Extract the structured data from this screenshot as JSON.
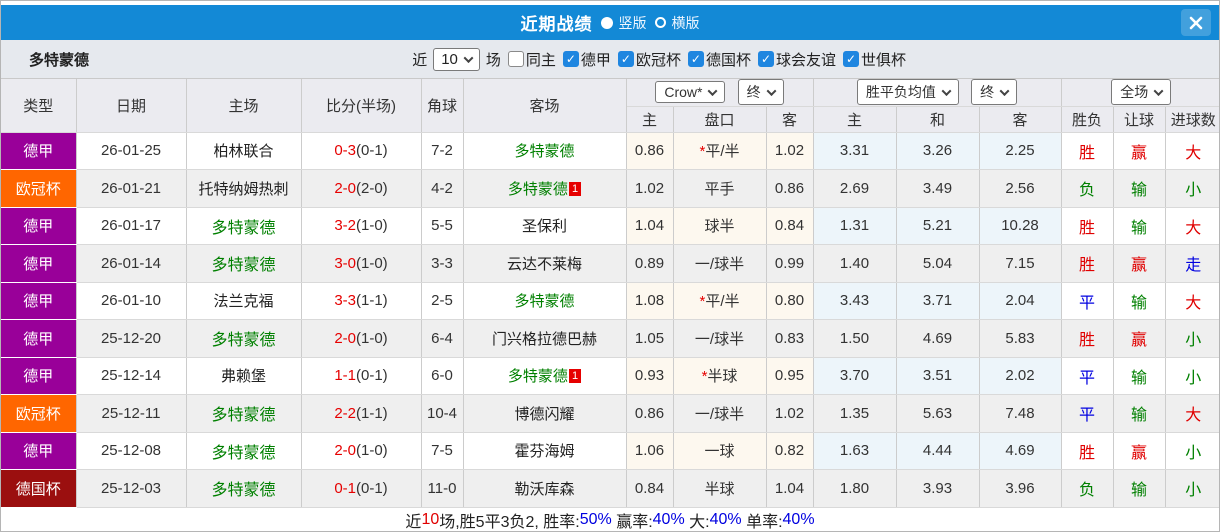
{
  "titlebar": {
    "title": "近期战绩",
    "layout_options": [
      {
        "label": "竖版",
        "selected": true
      },
      {
        "label": "横版",
        "selected": false
      }
    ]
  },
  "filter": {
    "team": "多特蒙德",
    "near_label": "近",
    "match_count": "10",
    "games_label": "场",
    "checkboxes": [
      {
        "label": "同主",
        "checked": false
      },
      {
        "label": "德甲",
        "checked": true
      },
      {
        "label": "欧冠杯",
        "checked": true
      },
      {
        "label": "德国杯",
        "checked": true
      },
      {
        "label": "球会友谊",
        "checked": true
      },
      {
        "label": "世俱杯",
        "checked": true
      }
    ]
  },
  "table": {
    "header_left": [
      "类型",
      "日期",
      "主场",
      "比分(半场)",
      "角球",
      "客场"
    ],
    "controls": {
      "odds_company": "Crow*",
      "odds_company_time": "终",
      "avg_select": "胜平负均值",
      "avg_time": "终",
      "scope_select": "全场"
    },
    "subheader": [
      "主",
      "盘口",
      "客",
      "主",
      "和",
      "客",
      "胜负",
      "让球",
      "进球数"
    ],
    "rows": [
      {
        "type": "德甲",
        "type_color": "purple",
        "date": "26-01-25",
        "home": "柏林联合",
        "home_color": "black",
        "score": "0-3",
        "half": "(0-1)",
        "corner": "7-2",
        "away": "多特蒙德",
        "away_color": "green",
        "away_badge": "",
        "odds_home": "0.86",
        "handicap_star": "*",
        "handicap": "平/半",
        "odds_away": "1.02",
        "avg_home": "3.31",
        "avg_draw": "3.26",
        "avg_away": "2.25",
        "outcome": "胜",
        "outcome_color": "red",
        "spread": "赢",
        "spread_color": "red",
        "goals": "大",
        "goals_color": "red"
      },
      {
        "type": "欧冠杯",
        "type_color": "orange",
        "date": "26-01-21",
        "home": "托特纳姆热刺",
        "home_color": "black",
        "score": "2-0",
        "half": "(2-0)",
        "corner": "4-2",
        "away": "多特蒙德",
        "away_color": "green",
        "away_badge": "1",
        "odds_home": "1.02",
        "handicap_star": "",
        "handicap": "平手",
        "odds_away": "0.86",
        "avg_home": "2.69",
        "avg_draw": "3.49",
        "avg_away": "2.56",
        "outcome": "负",
        "outcome_color": "green",
        "spread": "输",
        "spread_color": "green",
        "goals": "小",
        "goals_color": "green"
      },
      {
        "type": "德甲",
        "type_color": "purple",
        "date": "26-01-17",
        "home": "多特蒙德",
        "home_color": "green",
        "score": "3-2",
        "half": "(1-0)",
        "corner": "5-5",
        "away": "圣保利",
        "away_color": "black",
        "away_badge": "",
        "odds_home": "1.04",
        "handicap_star": "",
        "handicap": "球半",
        "odds_away": "0.84",
        "avg_home": "1.31",
        "avg_draw": "5.21",
        "avg_away": "10.28",
        "outcome": "胜",
        "outcome_color": "red",
        "spread": "输",
        "spread_color": "green",
        "goals": "大",
        "goals_color": "red"
      },
      {
        "type": "德甲",
        "type_color": "purple",
        "date": "26-01-14",
        "home": "多特蒙德",
        "home_color": "green",
        "score": "3-0",
        "half": "(1-0)",
        "corner": "3-3",
        "away": "云达不莱梅",
        "away_color": "black",
        "away_badge": "",
        "odds_home": "0.89",
        "handicap_star": "",
        "handicap": "一/球半",
        "odds_away": "0.99",
        "avg_home": "1.40",
        "avg_draw": "5.04",
        "avg_away": "7.15",
        "outcome": "胜",
        "outcome_color": "red",
        "spread": "赢",
        "spread_color": "red",
        "goals": "走",
        "goals_color": "blue"
      },
      {
        "type": "德甲",
        "type_color": "purple",
        "date": "26-01-10",
        "home": "法兰克福",
        "home_color": "black",
        "score": "3-3",
        "half": "(1-1)",
        "corner": "2-5",
        "away": "多特蒙德",
        "away_color": "green",
        "away_badge": "",
        "odds_home": "1.08",
        "handicap_star": "*",
        "handicap": "平/半",
        "odds_away": "0.80",
        "avg_home": "3.43",
        "avg_draw": "3.71",
        "avg_away": "2.04",
        "outcome": "平",
        "outcome_color": "blue",
        "spread": "输",
        "spread_color": "green",
        "goals": "大",
        "goals_color": "red"
      },
      {
        "type": "德甲",
        "type_color": "purple",
        "date": "25-12-20",
        "home": "多特蒙德",
        "home_color": "green",
        "score": "2-0",
        "half": "(1-0)",
        "corner": "6-4",
        "away": "门兴格拉德巴赫",
        "away_color": "black",
        "away_badge": "",
        "odds_home": "1.05",
        "handicap_star": "",
        "handicap": "一/球半",
        "odds_away": "0.83",
        "avg_home": "1.50",
        "avg_draw": "4.69",
        "avg_away": "5.83",
        "outcome": "胜",
        "outcome_color": "red",
        "spread": "赢",
        "spread_color": "red",
        "goals": "小",
        "goals_color": "green"
      },
      {
        "type": "德甲",
        "type_color": "purple",
        "date": "25-12-14",
        "home": "弗赖堡",
        "home_color": "black",
        "score": "1-1",
        "half": "(0-1)",
        "corner": "6-0",
        "away": "多特蒙德",
        "away_color": "green",
        "away_badge": "1",
        "odds_home": "0.93",
        "handicap_star": "*",
        "handicap": "半球",
        "odds_away": "0.95",
        "avg_home": "3.70",
        "avg_draw": "3.51",
        "avg_away": "2.02",
        "outcome": "平",
        "outcome_color": "blue",
        "spread": "输",
        "spread_color": "green",
        "goals": "小",
        "goals_color": "green"
      },
      {
        "type": "欧冠杯",
        "type_color": "orange",
        "date": "25-12-11",
        "home": "多特蒙德",
        "home_color": "green",
        "score": "2-2",
        "half": "(1-1)",
        "corner": "10-4",
        "away": "博德闪耀",
        "away_color": "black",
        "away_badge": "",
        "odds_home": "0.86",
        "handicap_star": "",
        "handicap": "一/球半",
        "odds_away": "1.02",
        "avg_home": "1.35",
        "avg_draw": "5.63",
        "avg_away": "7.48",
        "outcome": "平",
        "outcome_color": "blue",
        "spread": "输",
        "spread_color": "green",
        "goals": "大",
        "goals_color": "red"
      },
      {
        "type": "德甲",
        "type_color": "purple",
        "date": "25-12-08",
        "home": "多特蒙德",
        "home_color": "green",
        "score": "2-0",
        "half": "(1-0)",
        "corner": "7-5",
        "away": "霍芬海姆",
        "away_color": "black",
        "away_badge": "",
        "odds_home": "1.06",
        "handicap_star": "",
        "handicap": "一球",
        "odds_away": "0.82",
        "avg_home": "1.63",
        "avg_draw": "4.44",
        "avg_away": "4.69",
        "outcome": "胜",
        "outcome_color": "red",
        "spread": "赢",
        "spread_color": "red",
        "goals": "小",
        "goals_color": "green"
      },
      {
        "type": "德国杯",
        "type_color": "darkred",
        "date": "25-12-03",
        "home": "多特蒙德",
        "home_color": "green",
        "score": "0-1",
        "half": "(0-1)",
        "corner": "11-0",
        "away": "勒沃库森",
        "away_color": "black",
        "away_badge": "",
        "odds_home": "0.84",
        "handicap_star": "",
        "handicap": "半球",
        "odds_away": "1.04",
        "avg_home": "1.80",
        "avg_draw": "3.93",
        "avg_away": "3.96",
        "outcome": "负",
        "outcome_color": "green",
        "spread": "输",
        "spread_color": "green",
        "goals": "小",
        "goals_color": "green"
      }
    ]
  },
  "summary": {
    "parts": [
      {
        "text": "近",
        "color": "black"
      },
      {
        "text": "10",
        "color": "red"
      },
      {
        "text": "场,胜5平3负2, 胜率:",
        "color": "black"
      },
      {
        "text": "50%",
        "color": "blue"
      },
      {
        "text": " 赢率:",
        "color": "black"
      },
      {
        "text": "40%",
        "color": "blue"
      },
      {
        "text": " 大:",
        "color": "black"
      },
      {
        "text": "40%",
        "color": "blue"
      },
      {
        "text": " 单率:",
        "color": "black"
      },
      {
        "text": "40%",
        "color": "blue"
      }
    ]
  },
  "colors": {
    "titlebar_blue": "#1389d6",
    "league_purple": "#990099",
    "cup_orange": "#ff6600",
    "cup_darkred": "#9b0f0f",
    "win_red": "#e00000",
    "lose_green": "#008000",
    "draw_blue": "#0000e0",
    "team_green": "#008000",
    "handicap_bg_cream": "#fdf8ef",
    "avg_bg_lightblue": "#edf5fa"
  }
}
